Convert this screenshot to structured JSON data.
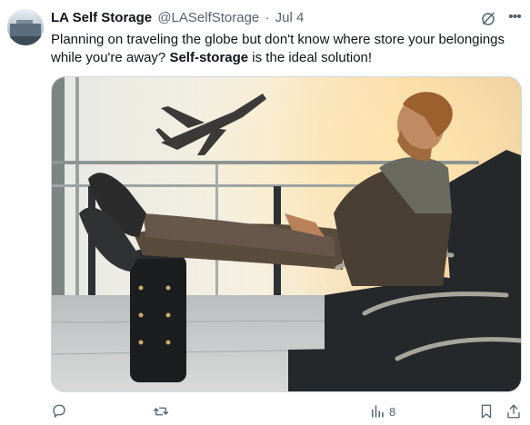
{
  "tweet": {
    "author_name": "LA Self Storage",
    "handle": "@LASelfStorage",
    "separator": "·",
    "date": "Jul 4",
    "text_before": "Planning on traveling the globe but don't know where store your belongings while you're away? ",
    "text_bold": "Self-storage",
    "text_after": " is the ideal solution!"
  },
  "actions": {
    "reply_icon": "reply-icon",
    "retweet_icon": "retweet-icon",
    "like_icon": "heart-icon",
    "views_icon": "views-icon",
    "views_count": "8",
    "bookmark_icon": "bookmark-icon",
    "share_icon": "share-icon"
  },
  "icons": {
    "grok": "grok-icon",
    "more": "more-icon"
  },
  "colors": {
    "text": "#0f1419",
    "secondary": "#536471",
    "border": "#cfd9de"
  }
}
